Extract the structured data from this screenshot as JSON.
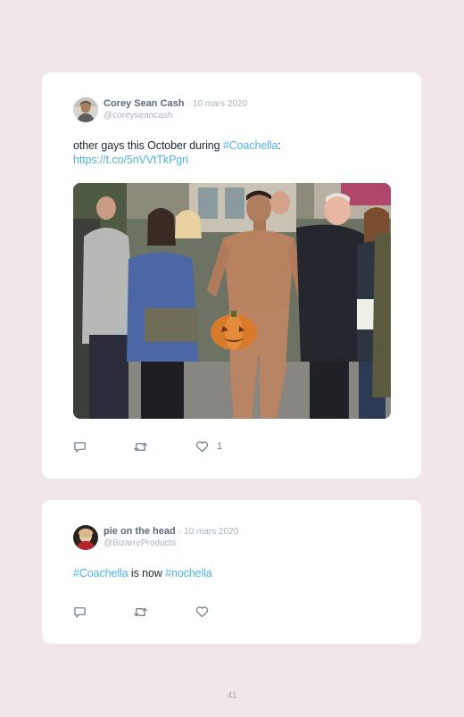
{
  "tweets": [
    {
      "author": "Corey Sean Cash",
      "separator": "·",
      "date": "10 mars 2020",
      "handle": "@coreyseancash",
      "text_pre": "other gays this October during ",
      "hashtag": "#Coachella",
      "text_post": ":",
      "url": "https://t.co/5nVVtTkPgri",
      "likes": "1",
      "icons": [
        "reply-icon",
        "retweet-icon",
        "heart-icon"
      ]
    },
    {
      "author": "pie on the head",
      "separator": "·",
      "date": "10 mars 2020",
      "handle": "@BizarreProducts",
      "hashtag1": "#Coachella",
      "middle": " is now ",
      "hashtag2": "#nochella",
      "icons": [
        "reply-icon",
        "retweet-icon",
        "heart-icon"
      ]
    }
  ],
  "page_number": "41",
  "colors": {
    "background": "#f1e6ec",
    "card": "#ffffff",
    "link": "#4fb3e3",
    "name": "#5b6a78",
    "meta": "#a9b3bd",
    "icon": "#6e7b86"
  }
}
